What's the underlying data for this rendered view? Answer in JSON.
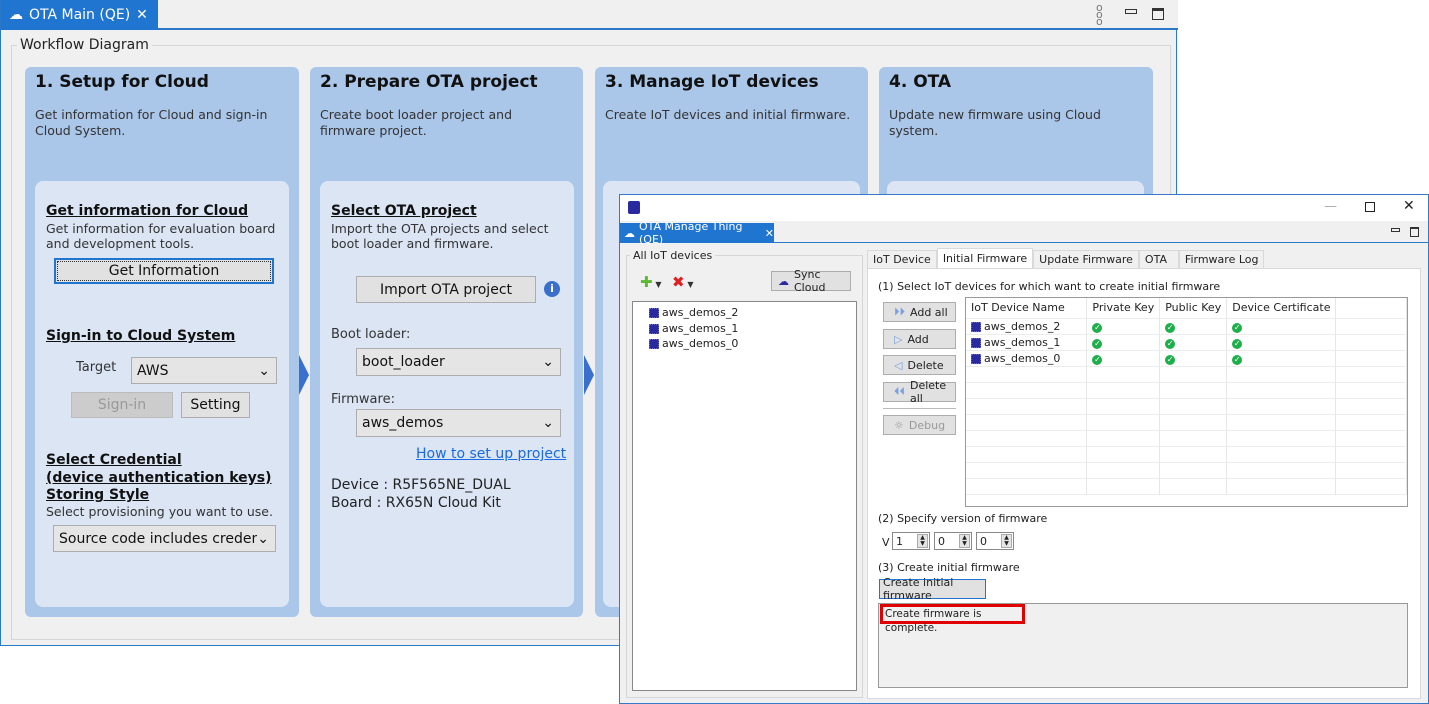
{
  "main": {
    "tab_title": "OTA Main (QE)",
    "group_label": "Workflow Diagram",
    "cards": [
      {
        "title": "1. Setup for Cloud",
        "desc": "Get information for Cloud and sign-in Cloud System."
      },
      {
        "title": "2. Prepare OTA project",
        "desc": "Create boot loader project and firmware project."
      },
      {
        "title": "3. Manage IoT devices",
        "desc": "Create IoT devices and initial firmware."
      },
      {
        "title": "4. OTA",
        "desc": "Update new firmware using Cloud system."
      }
    ],
    "setup": {
      "get_info_heading": "Get information for Cloud",
      "get_info_desc": "Get information for evaluation board and development tools.",
      "get_info_button": "Get Information",
      "signin_heading": "Sign-in to Cloud System",
      "target_label": "Target",
      "target_value": "AWS",
      "signin_button": "Sign-in",
      "setting_button": "Setting",
      "cred_heading_1": "Select Credential",
      "cred_heading_2": "(device authentication keys)",
      "cred_heading_3": "Storing Style",
      "cred_desc": "Select provisioning you want to use.",
      "cred_value": "Source code includes credentia"
    },
    "prepare": {
      "heading": "Select OTA project",
      "desc": "Import the OTA projects and select boot loader and firmware.",
      "import_button": "Import OTA project",
      "boot_label": "Boot loader:",
      "boot_value": "boot_loader",
      "fw_label": "Firmware:",
      "fw_value": "aws_demos",
      "howto_link": "How to set up project",
      "device": "Device : R5F565NE_DUAL",
      "board": "Board : RX65N Cloud Kit"
    }
  },
  "dialog": {
    "tab_title": "OTA Manage Thing (QE)",
    "devices_group": "All IoT devices",
    "sync_button": "Sync Cloud",
    "devices": [
      "aws_demos_2",
      "aws_demos_1",
      "aws_demos_0"
    ],
    "tabs": [
      "IoT Device",
      "Initial Firmware",
      "Update Firmware",
      "OTA",
      "Firmware Log"
    ],
    "active_tab": "Initial Firmware",
    "step1": "(1) Select IoT devices for which want to create initial firmware",
    "buttons": {
      "add_all": "Add all",
      "add": "Add",
      "delete": "Delete",
      "delete_all": "Delete all",
      "debug": "Debug"
    },
    "columns": [
      "IoT Device Name",
      "Private Key",
      "Public Key",
      "Device Certificate"
    ],
    "rows": [
      {
        "name": "aws_demos_2",
        "private_key": true,
        "public_key": true,
        "certificate": true
      },
      {
        "name": "aws_demos_1",
        "private_key": true,
        "public_key": true,
        "certificate": true
      },
      {
        "name": "aws_demos_0",
        "private_key": true,
        "public_key": true,
        "certificate": true
      }
    ],
    "step2": "(2) Specify version of firmware",
    "version_prefix": "V",
    "version": [
      "1",
      "0",
      "0"
    ],
    "step3": "(3) Create initial firmware",
    "create_button": "Create initial firmware",
    "output": "Create firmware is complete."
  },
  "colors": {
    "accent": "#1f75d0",
    "card": "#aac6e8",
    "inner": "#dbe5f4",
    "highlight": "#e00000",
    "ok": "#1fae4b"
  }
}
